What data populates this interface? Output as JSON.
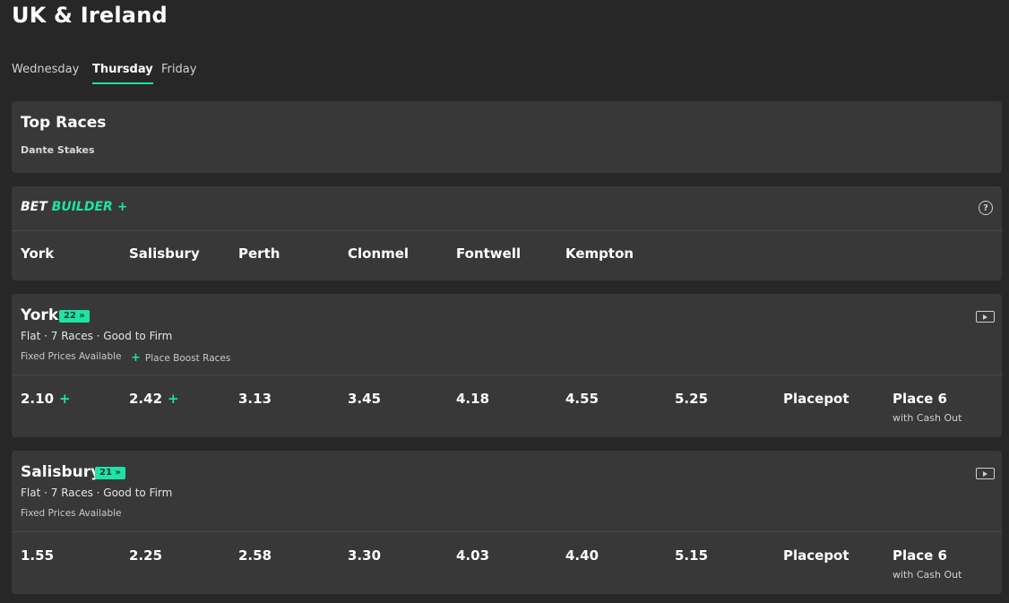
{
  "page_title": "UK & Ireland",
  "tabs": [
    "Wednesday",
    "Thursday",
    "Friday"
  ],
  "active_tab": "Thursday",
  "top_races": {
    "title": "Top Races",
    "items": [
      "Dante Stakes"
    ]
  },
  "bet_builder": {
    "logo_part1": "BET",
    "logo_part2": "BUILDER",
    "logo_plus": "+",
    "help_icon": "question-circle-icon",
    "venues": [
      "York",
      "Salisbury",
      "Perth",
      "Clonmel",
      "Fontwell",
      "Kempton"
    ]
  },
  "meetings": [
    {
      "name": "York",
      "badge": "22 »",
      "info": "Flat · 7 Races · Good to Firm",
      "tags": [
        "Fixed Prices Available",
        "Place Boost Races"
      ],
      "races": [
        {
          "time": "2.10",
          "boost": "+"
        },
        {
          "time": "2.42",
          "boost": "+"
        },
        {
          "time": "3.13"
        },
        {
          "time": "3.45"
        },
        {
          "time": "4.18"
        },
        {
          "time": "4.55"
        },
        {
          "time": "5.25"
        }
      ],
      "extras": [
        {
          "label": "Placepot"
        },
        {
          "label": "Place 6",
          "sub": "with Cash Out"
        }
      ]
    },
    {
      "name": "Salisbury",
      "badge": "21 »",
      "info": "Flat · 7 Races · Good to Firm",
      "tags": [
        "Fixed Prices Available"
      ],
      "races": [
        {
          "time": "1.55"
        },
        {
          "time": "2.25"
        },
        {
          "time": "2.58"
        },
        {
          "time": "3.30"
        },
        {
          "time": "4.03"
        },
        {
          "time": "4.40"
        },
        {
          "time": "5.15"
        }
      ],
      "extras": [
        {
          "label": "Placepot"
        },
        {
          "label": "Place 6",
          "sub": "with Cash Out"
        }
      ]
    }
  ],
  "colors": {
    "background": "#272727",
    "card": "#383838",
    "accent": "#1ee3a4"
  }
}
